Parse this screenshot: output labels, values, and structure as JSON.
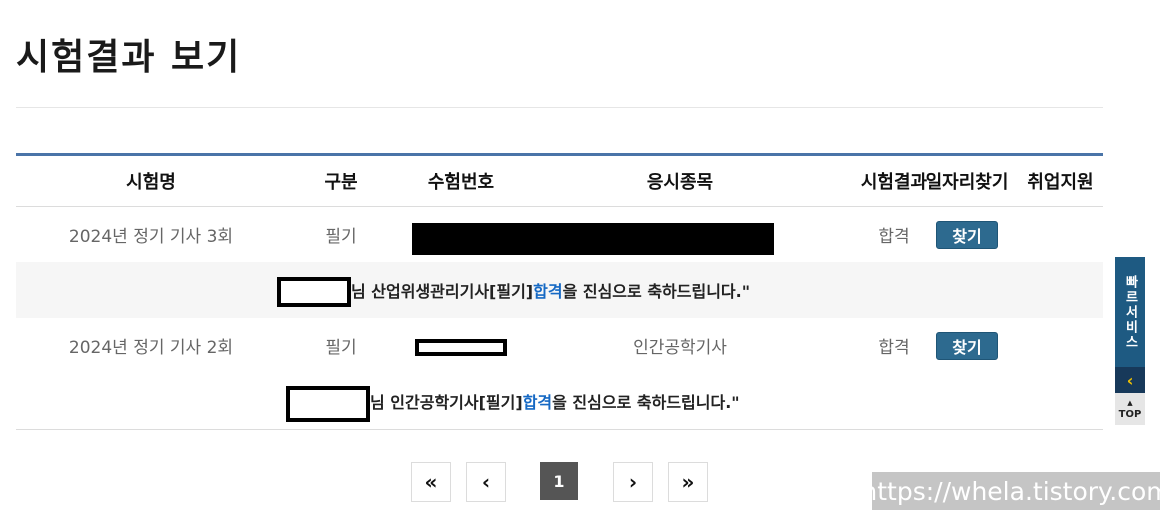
{
  "page": {
    "title": "시험결과 보기"
  },
  "table": {
    "headers": {
      "name": "시험명",
      "type": "구분",
      "number": "수험번호",
      "subject": "응시종목",
      "result": "시험결과",
      "job": "일자리찾기",
      "support": "취업지원"
    },
    "rows": [
      {
        "name": "2024년 정기 기사 3회",
        "type": "필기",
        "subject": "",
        "result": "합격",
        "button": "찾기",
        "message": {
          "before": "님 산업위생관리기사[필기] ",
          "pass": "합격",
          "after": "을 진심으로 축하드립니다.\""
        }
      },
      {
        "name": "2024년 정기 기사 2회",
        "type": "필기",
        "subject": "인간공학기사",
        "result": "합격",
        "button": "찾기",
        "message": {
          "before": "님 인간공학기사[필기] ",
          "pass": "합격",
          "after": "을 진심으로 축하드립니다.\""
        }
      }
    ]
  },
  "pagination": {
    "first": "«",
    "prev": "‹",
    "current": "1",
    "next": "›",
    "last": "»"
  },
  "side_menu": {
    "fast_service": "빠르서비스",
    "arrow": "‹",
    "top": "TOP",
    "top_arrow": "▲"
  },
  "watermark": "https://whela.tistory.com",
  "colors": {
    "accent": "#4a74a8",
    "button": "#2d6a8f",
    "pass": "#1669c4"
  }
}
